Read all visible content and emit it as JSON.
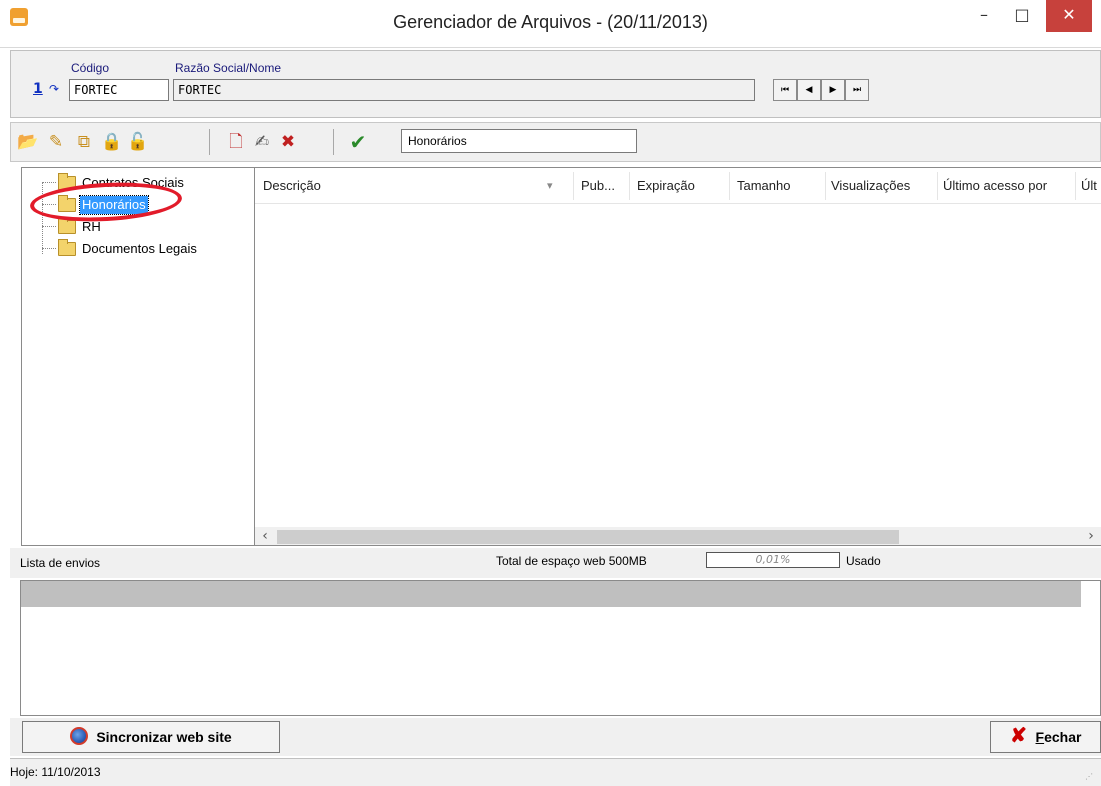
{
  "window": {
    "title": "Gerenciador de Arquivos - (20/11/2013)",
    "minimize": "–",
    "maximize": "□",
    "close": "✕"
  },
  "header": {
    "codigo_label": "Código",
    "razao_label": "Razão Social/Nome",
    "codigo_value": "FORTEC",
    "razao_value": "FORTEC",
    "code_link": "1",
    "nav": [
      "⏮",
      "◀",
      "▶",
      "⏭"
    ]
  },
  "toolbar": {
    "icons": [
      "folder-new-icon",
      "folder-edit-icon",
      "folder-copy-icon",
      "lock-icon",
      "unlock-icon",
      "file-new-icon",
      "file-edit-icon",
      "file-delete-icon",
      "check-icon"
    ],
    "selected_folder": "Honorários"
  },
  "tree": {
    "items": [
      {
        "label": "Contratos Sociais",
        "selected": false
      },
      {
        "label": "Honorários",
        "selected": true
      },
      {
        "label": "RH",
        "selected": false
      },
      {
        "label": "Documentos Legais",
        "selected": false
      }
    ]
  },
  "grid": {
    "columns": [
      "Descrição",
      "Pub...",
      "Expiração",
      "Tamanho",
      "Visualizações",
      "Último acesso por",
      "Últ"
    ],
    "sort_indicator": "▾",
    "rows": []
  },
  "envios": {
    "label": "Lista de envios",
    "total_label": "Total de espaço web 500MB",
    "usage_value": "0,01%",
    "usado_label": "Usado"
  },
  "buttons": {
    "sync": "Sincronizar web site",
    "close": "Fechar"
  },
  "status": {
    "text": "Hoje: 11/10/2013"
  },
  "colors": {
    "selection": "#3399ff",
    "close_button": "#c7413c",
    "annotation": "#e21b2a"
  }
}
